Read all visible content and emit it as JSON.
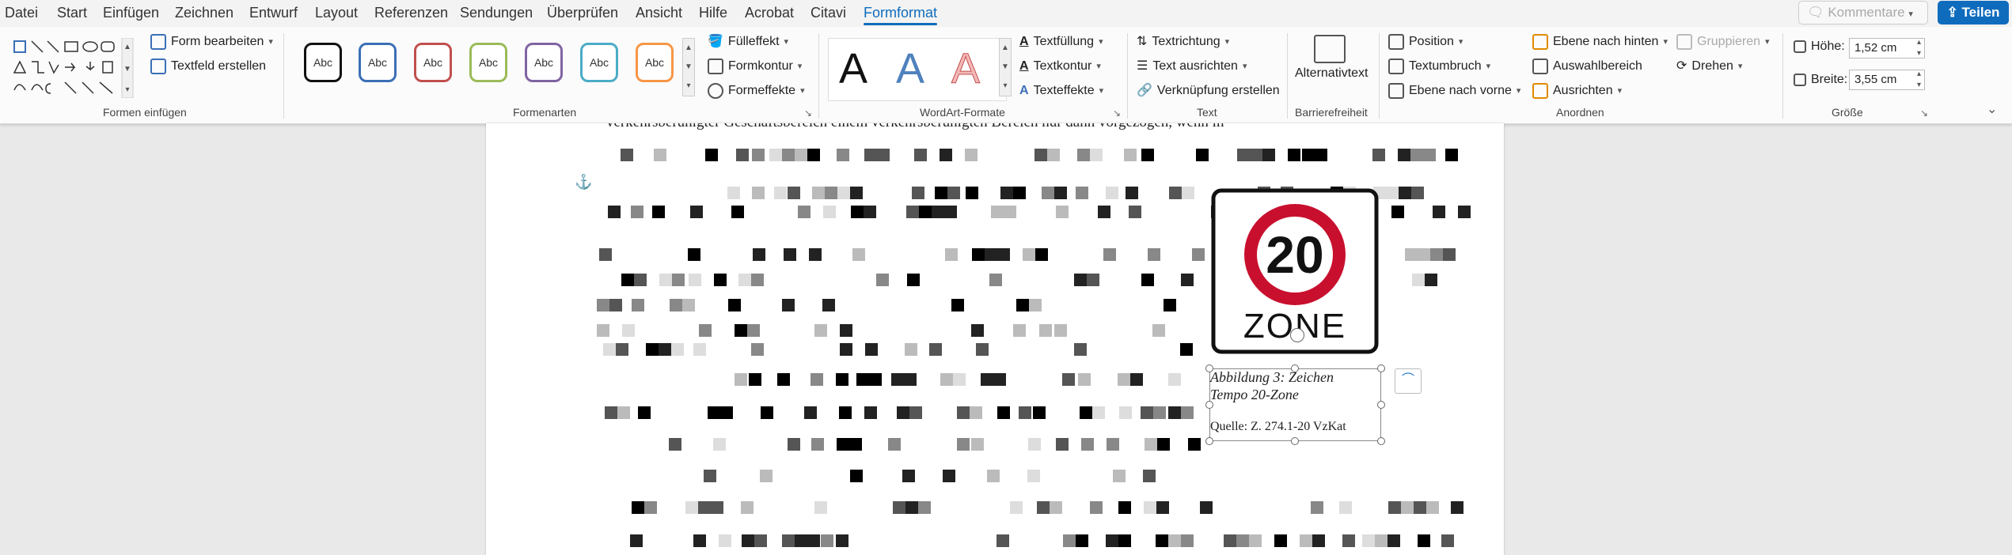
{
  "tabs": [
    "Datei",
    "Start",
    "Einfügen",
    "Zeichnen",
    "Entwurf",
    "Layout",
    "Referenzen",
    "Sendungen",
    "Überprüfen",
    "Ansicht",
    "Hilfe",
    "Acrobat",
    "Citavi",
    "Formformat"
  ],
  "active_tab": "Formformat",
  "header": {
    "comments_label": "Kommentare",
    "share_label": "Teilen"
  },
  "groups": {
    "insert_shapes": {
      "label": "Formen einfügen",
      "edit_shape": "Form bearbeiten",
      "textbox": "Textfeld erstellen"
    },
    "shape_styles": {
      "label": "Formenarten",
      "style_text": "Abc",
      "fill": "Fülleffekt",
      "outline": "Formkontur",
      "effects": "Formeffekte"
    },
    "wordart": {
      "label": "WordArt-Formate",
      "letter": "A",
      "text_fill": "Textfüllung",
      "text_outline": "Textkontur",
      "text_effects": "Texteffekte"
    },
    "text": {
      "label": "Text",
      "direction": "Textrichtung",
      "align": "Text ausrichten",
      "link": "Verknüpfung erstellen"
    },
    "accessibility": {
      "label": "Barrierefreiheit",
      "alt_text": "Alternativtext"
    },
    "arrange": {
      "label": "Anordnen",
      "position": "Position",
      "wrap": "Textumbruch",
      "forward": "Ebene nach vorne",
      "backward": "Ebene nach hinten",
      "selection": "Auswahlbereich",
      "align": "Ausrichten",
      "group": "Gruppieren",
      "rotate": "Drehen"
    },
    "size": {
      "label": "Größe",
      "height_label": "Höhe:",
      "height_value": "1,52 cm",
      "width_label": "Breite:",
      "width_value": "3,55 cm"
    }
  },
  "document": {
    "top_text": "verkehrsberuhigter Geschäftsbereich einem verkehrsberuhigten Bereich nur dann vorgezogen, wenn in",
    "sign": {
      "number": "20",
      "word": "ZONE"
    },
    "caption_line1": "Abbildung 3: Zeichen",
    "caption_line2": "Tempo 20-Zone",
    "source": "Quelle: Z. 274.1-20 VzKat"
  },
  "colors": {
    "accent": "#0f6cbd",
    "sign_red": "#c8102e"
  }
}
